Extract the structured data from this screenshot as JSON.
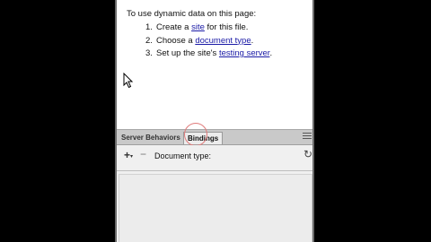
{
  "instructions": {
    "intro": "To use dynamic data on this page:",
    "steps": [
      {
        "num": "1.",
        "before": "Create a ",
        "link": "site",
        "after": " for this file."
      },
      {
        "num": "2.",
        "before": "Choose a ",
        "link": "document type",
        "after": "."
      },
      {
        "num": "3.",
        "before": "Set up the site's ",
        "link": "testing server",
        "after": "."
      }
    ]
  },
  "tabs": [
    {
      "label": "Server Behaviors",
      "active": false
    },
    {
      "label": "Bindings",
      "active": true
    }
  ],
  "toolbar": {
    "plus": "+",
    "dropdown_arrow": "▾",
    "minus": "−",
    "document_type_label": "Document type:",
    "refresh": "↻"
  },
  "icons": {
    "cursor": "arrow-cursor-icon",
    "panel_menu": "panel-options-icon",
    "refresh": "refresh-icon"
  },
  "colors": {
    "link": "#1a1aa6",
    "highlight": "#e07a7a",
    "tabbar": "#c9c9c9"
  }
}
